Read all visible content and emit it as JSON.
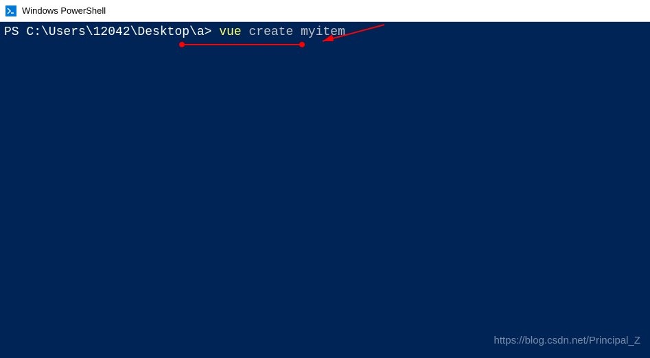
{
  "window": {
    "title": "Windows PowerShell"
  },
  "terminal": {
    "prompt": "PS C:\\Users\\12042\\Desktop\\a> ",
    "command_keyword": "vue",
    "command_args": " create myitem"
  },
  "watermark": {
    "text": "https://blog.csdn.net/Principal_Z"
  },
  "annotation": {
    "underline_color": "#ff0000",
    "arrow_color": "#ff0000"
  }
}
